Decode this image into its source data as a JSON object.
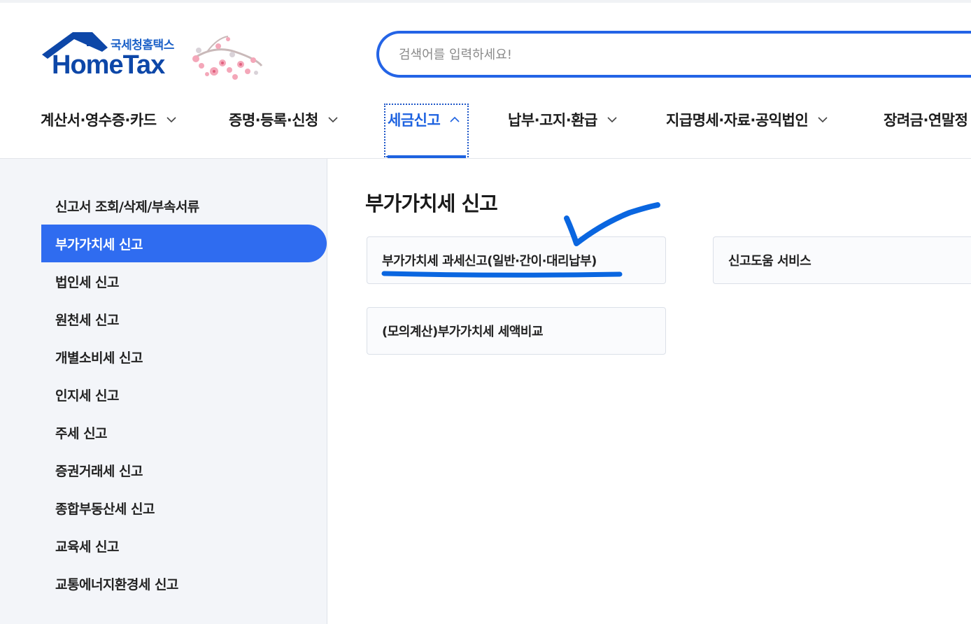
{
  "header": {
    "logo": {
      "subtitle": "국세청홈택스",
      "title": "HomeTax"
    },
    "search": {
      "placeholder": "검색어를 입력하세요!"
    }
  },
  "nav": {
    "items": [
      {
        "label": "계산서·영수증·카드",
        "active": false
      },
      {
        "label": "증명·등록·신청",
        "active": false
      },
      {
        "label": "세금신고",
        "active": true
      },
      {
        "label": "납부·고지·환급",
        "active": false
      },
      {
        "label": "지급명세·자료·공익법인",
        "active": false
      },
      {
        "label": "장려금·연말정",
        "active": false
      }
    ]
  },
  "sidebar": {
    "items": [
      {
        "label": "신고서 조회/삭제/부속서류",
        "active": false
      },
      {
        "label": "부가가치세 신고",
        "active": true
      },
      {
        "label": "법인세 신고",
        "active": false
      },
      {
        "label": "원천세 신고",
        "active": false
      },
      {
        "label": "개별소비세 신고",
        "active": false
      },
      {
        "label": "인지세 신고",
        "active": false
      },
      {
        "label": "주세 신고",
        "active": false
      },
      {
        "label": "증권거래세 신고",
        "active": false
      },
      {
        "label": "종합부동산세 신고",
        "active": false
      },
      {
        "label": "교육세 신고",
        "active": false
      },
      {
        "label": "교통에너지환경세 신고",
        "active": false
      }
    ]
  },
  "main": {
    "title": "부가가치세 신고",
    "cards": [
      {
        "label": "부가가치세 과세신고(일반·간이·대리납부)"
      },
      {
        "label": "신고도움 서비스"
      },
      {
        "label": "(모의계산)부가가치세 세액비교"
      }
    ]
  },
  "colors": {
    "brand": "#0d47a8",
    "accent": "#2f6cf0",
    "annotation": "#0a66e0"
  }
}
